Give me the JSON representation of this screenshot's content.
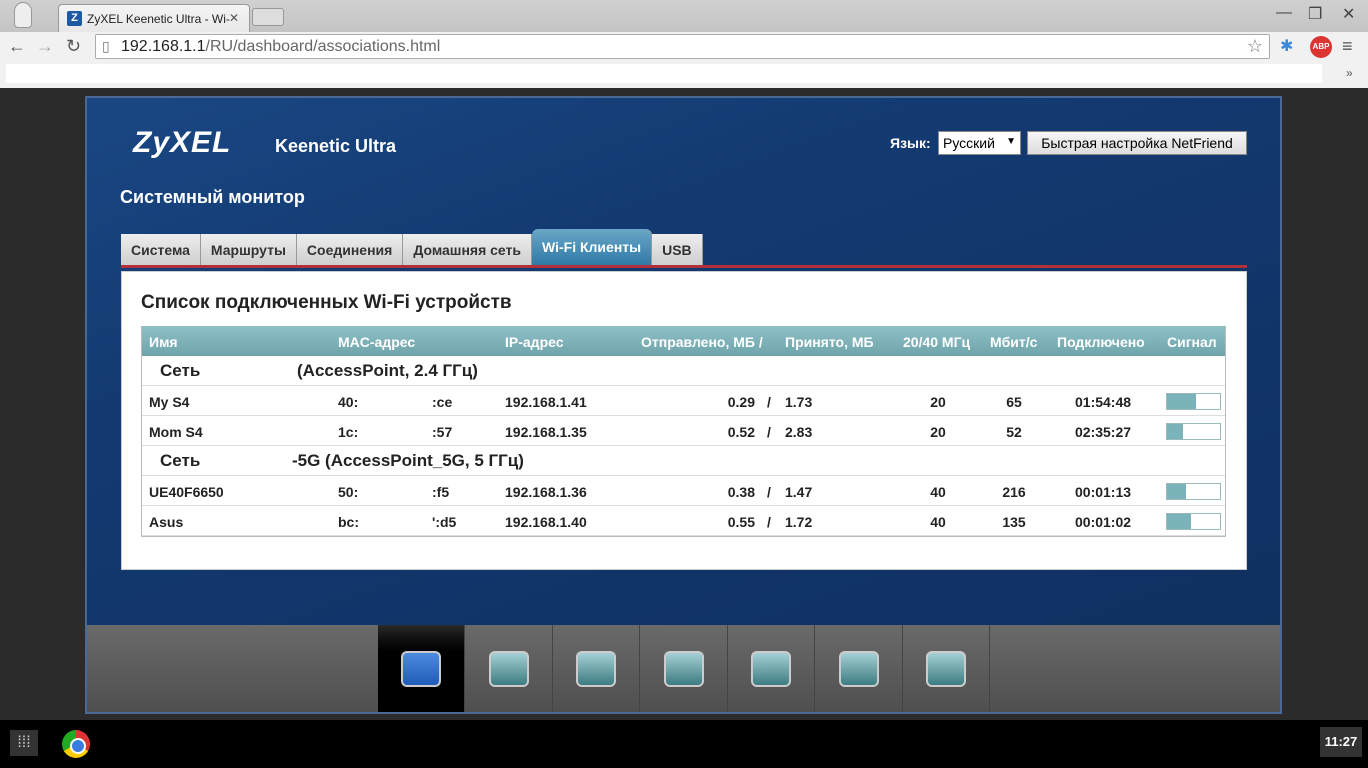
{
  "browser": {
    "tab_title": "ZyXEL Keenetic Ultra - Wi-",
    "tab_favicon": "Z",
    "url_host": "192.168.1.1",
    "url_path": "/RU/dashboard/associations.html",
    "abp_label": "ABP",
    "min": "—",
    "restore": "❐",
    "close": "✕"
  },
  "header": {
    "logo": "ZyXEL",
    "model": "Keenetic Ultra",
    "lang_label": "Язык:",
    "lang_value": "Русский",
    "netfriend": "Быстрая настройка NetFriend",
    "page_title": "Системный монитор"
  },
  "tabs": [
    "Система",
    "Маршруты",
    "Соединения",
    "Домашняя сеть",
    "Wi-Fi Клиенты",
    "USB"
  ],
  "panel": {
    "title": "Список подключенных Wi-Fi устройств",
    "columns": {
      "name": "Имя",
      "mac": "MAC-адрес",
      "ip": "IP-адрес",
      "sent": "Отправлено, МБ  /",
      "recv": "Принято, МБ",
      "bw": "20/40 МГц",
      "rate": "Мбит/с",
      "connected": "Подключено",
      "signal": "Сигнал"
    },
    "groups": [
      {
        "label": "Сеть",
        "ssid": "(AccessPoint, 2.4 ГГц)",
        "clients": [
          {
            "name": "My S4",
            "mac_start": "40:",
            "mac_end": ":ce",
            "ip": "192.168.1.41",
            "sent": "0.29",
            "sep": "/",
            "recv": "1.73",
            "bw": "20",
            "rate": "65",
            "connected": "01:54:48",
            "signal": 0.55
          },
          {
            "name": "Mom S4",
            "mac_start": "1c:",
            "mac_end": ":57",
            "ip": "192.168.1.35",
            "sent": "0.52",
            "sep": "/",
            "recv": "2.83",
            "bw": "20",
            "rate": "52",
            "connected": "02:35:27",
            "signal": 0.3
          }
        ]
      },
      {
        "label": "Сеть",
        "ssid": "-5G (AccessPoint_5G, 5 ГГц)",
        "clients": [
          {
            "name": "UE40F6650",
            "mac_start": "50:",
            "mac_end": ":f5",
            "ip": "192.168.1.36",
            "sent": "0.38",
            "sep": "/",
            "recv": "1.47",
            "bw": "40",
            "rate": "216",
            "connected": "00:01:13",
            "signal": 0.35
          },
          {
            "name": "Asus",
            "mac_start": "bc:",
            "mac_end": "':d5",
            "ip": "192.168.1.40",
            "sent": "0.55",
            "sep": "/",
            "recv": "1.72",
            "bw": "40",
            "rate": "135",
            "connected": "00:01:02",
            "signal": 0.45
          }
        ]
      }
    ]
  },
  "bottom_nav": [
    "monitor-icon",
    "internet-globe-icon",
    "home-network-icon",
    "wifi-signal-icon",
    "security-shield-icon",
    "system-gear-icon",
    "apps-grid-icon"
  ],
  "taskbar": {
    "clock": "11:27"
  }
}
